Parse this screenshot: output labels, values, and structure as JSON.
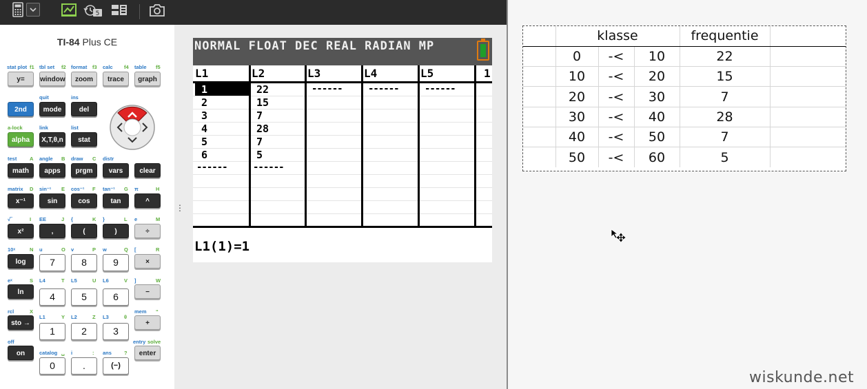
{
  "toolbar": {
    "icons": [
      "calculator-icon",
      "chevron-down-icon",
      "document-icon",
      "history-icon",
      "layout-icon",
      "camera-icon"
    ],
    "history_count": "5"
  },
  "calculator": {
    "model_bold": "TI-84",
    "model_rest": " Plus CE",
    "rows": [
      {
        "labels": [
          {
            "t": "stat plot",
            "c": "b"
          },
          {
            "t": "f1",
            "c": "g"
          },
          {
            "t": "tbl set",
            "c": "b"
          },
          {
            "t": "f2",
            "c": "g"
          },
          {
            "t": "format",
            "c": "b"
          },
          {
            "t": "f3",
            "c": "g"
          },
          {
            "t": "calc",
            "c": "b"
          },
          {
            "t": "f4",
            "c": "g"
          },
          {
            "t": "table",
            "c": "b"
          },
          {
            "t": "f5",
            "c": "g"
          }
        ],
        "keys": [
          "y=",
          "window",
          "zoom",
          "trace",
          "graph"
        ]
      },
      {
        "keys": [
          "2nd",
          "mode",
          "del"
        ],
        "labels": [
          {
            "t": "quit",
            "c": "b"
          },
          {
            "t": "ins",
            "c": "b"
          }
        ]
      },
      {
        "keys": [
          "alpha",
          "X,T,θ,n",
          "stat"
        ],
        "labels": [
          {
            "t": "a-lock",
            "c": "g"
          },
          {
            "t": "link",
            "c": "b"
          },
          {
            "t": "list",
            "c": "b"
          }
        ]
      },
      {
        "keys": [
          "math",
          "apps",
          "prgm",
          "vars",
          "clear"
        ],
        "labels": [
          {
            "t": "test",
            "c": "b"
          },
          {
            "t": "A",
            "c": "g"
          },
          {
            "t": "angle",
            "c": "b"
          },
          {
            "t": "B",
            "c": "g"
          },
          {
            "t": "draw",
            "c": "b"
          },
          {
            "t": "C",
            "c": "g"
          },
          {
            "t": "distr",
            "c": "b"
          }
        ]
      },
      {
        "keys": [
          "x⁻¹",
          "sin",
          "cos",
          "tan",
          "^"
        ],
        "labels": [
          {
            "t": "matrix",
            "c": "b"
          },
          {
            "t": "D",
            "c": "g"
          },
          {
            "t": "sin⁻¹",
            "c": "b"
          },
          {
            "t": "E",
            "c": "g"
          },
          {
            "t": "cos⁻¹",
            "c": "b"
          },
          {
            "t": "F",
            "c": "g"
          },
          {
            "t": "tan⁻¹",
            "c": "b"
          },
          {
            "t": "G",
            "c": "g"
          },
          {
            "t": "π",
            "c": "b"
          },
          {
            "t": "H",
            "c": "g"
          }
        ]
      },
      {
        "keys": [
          "x²",
          ",",
          "(",
          ")",
          "÷"
        ],
        "labels": [
          {
            "t": "√‾",
            "c": "b"
          },
          {
            "t": "I",
            "c": "g"
          },
          {
            "t": "EE",
            "c": "b"
          },
          {
            "t": "J",
            "c": "g"
          },
          {
            "t": "{",
            "c": "b"
          },
          {
            "t": "K",
            "c": "g"
          },
          {
            "t": "}",
            "c": "b"
          },
          {
            "t": "L",
            "c": "g"
          },
          {
            "t": "e",
            "c": "b"
          },
          {
            "t": "M",
            "c": "g"
          }
        ]
      },
      {
        "keys": [
          "log",
          "7",
          "8",
          "9",
          "×"
        ],
        "labels": [
          {
            "t": "10ˣ",
            "c": "b"
          },
          {
            "t": "N",
            "c": "g"
          },
          {
            "t": "u",
            "c": "b"
          },
          {
            "t": "O",
            "c": "g"
          },
          {
            "t": "v",
            "c": "b"
          },
          {
            "t": "P",
            "c": "g"
          },
          {
            "t": "w",
            "c": "b"
          },
          {
            "t": "Q",
            "c": "g"
          },
          {
            "t": "[",
            "c": "b"
          },
          {
            "t": "R",
            "c": "g"
          }
        ]
      },
      {
        "keys": [
          "ln",
          "4",
          "5",
          "6",
          "−"
        ],
        "labels": [
          {
            "t": "eˣ",
            "c": "b"
          },
          {
            "t": "S",
            "c": "g"
          },
          {
            "t": "L4",
            "c": "b"
          },
          {
            "t": "T",
            "c": "g"
          },
          {
            "t": "L5",
            "c": "b"
          },
          {
            "t": "U",
            "c": "g"
          },
          {
            "t": "L6",
            "c": "b"
          },
          {
            "t": "V",
            "c": "g"
          },
          {
            "t": "]",
            "c": "b"
          },
          {
            "t": "W",
            "c": "g"
          }
        ]
      },
      {
        "keys": [
          "sto →",
          "1",
          "2",
          "3",
          "+"
        ],
        "labels": [
          {
            "t": "rcl",
            "c": "b"
          },
          {
            "t": "X",
            "c": "g"
          },
          {
            "t": "L1",
            "c": "b"
          },
          {
            "t": "Y",
            "c": "g"
          },
          {
            "t": "L2",
            "c": "b"
          },
          {
            "t": "Z",
            "c": "g"
          },
          {
            "t": "L3",
            "c": "b"
          },
          {
            "t": "θ",
            "c": "g"
          },
          {
            "t": "mem",
            "c": "b"
          },
          {
            "t": "“",
            "c": "g"
          }
        ]
      },
      {
        "keys": [
          "on",
          "0",
          ".",
          "(−)",
          "enter"
        ],
        "labels": [
          {
            "t": "off",
            "c": "b"
          },
          {
            "t": "catalog",
            "c": "b"
          },
          {
            "t": "␣",
            "c": "g"
          },
          {
            "t": "i",
            "c": "b"
          },
          {
            "t": ":",
            "c": "g"
          },
          {
            "t": "ans",
            "c": "b"
          },
          {
            "t": "?",
            "c": "g"
          },
          {
            "t": "entry",
            "c": "b"
          },
          {
            "t": "solve",
            "c": "g"
          }
        ]
      }
    ]
  },
  "screen": {
    "status": "NORMAL FLOAT DEC REAL RADIAN MP",
    "columns": [
      "L1",
      "L2",
      "L3",
      "L4",
      "L5",
      "1"
    ],
    "L1": [
      "1",
      "2",
      "3",
      "4",
      "5",
      "6"
    ],
    "L2": [
      "22",
      "15",
      "7",
      "28",
      "7",
      "5"
    ],
    "dash": "------",
    "entry": "L1(1)=1"
  },
  "document": {
    "table": {
      "headers": [
        "klasse",
        "frequentie"
      ],
      "rows": [
        [
          "0",
          "-<",
          "10",
          "22"
        ],
        [
          "10",
          "-<",
          "20",
          "15"
        ],
        [
          "20",
          "-<",
          "30",
          "7"
        ],
        [
          "30",
          "-<",
          "40",
          "28"
        ],
        [
          "40",
          "-<",
          "50",
          "7"
        ],
        [
          "50",
          "-<",
          "60",
          "5"
        ]
      ]
    },
    "watermark": "wiskunde.net"
  }
}
